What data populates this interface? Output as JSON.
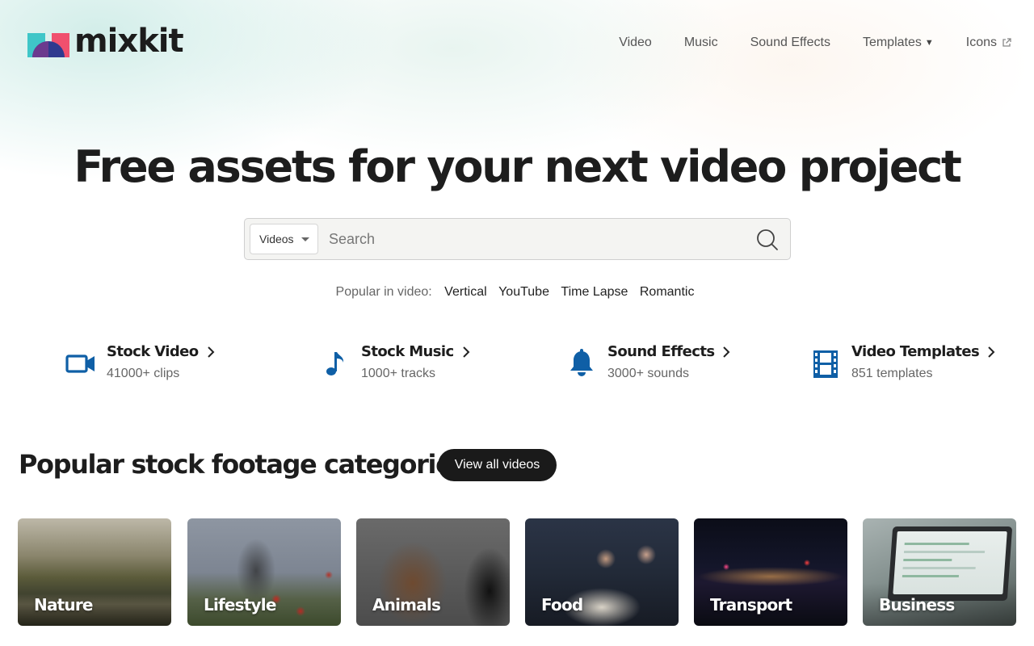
{
  "brand": {
    "name": "mixkit"
  },
  "nav": [
    {
      "label": "Video"
    },
    {
      "label": "Music"
    },
    {
      "label": "Sound Effects"
    },
    {
      "label": "Templates"
    },
    {
      "label": "Icons"
    }
  ],
  "hero": {
    "title": "Free assets for your next video project"
  },
  "search": {
    "type_selected": "Videos",
    "placeholder": "Search"
  },
  "popular": {
    "label": "Popular in video:",
    "tags": [
      "Vertical",
      "YouTube",
      "Time Lapse",
      "Romantic"
    ]
  },
  "stats": [
    {
      "title": "Stock Video",
      "sub": "41000+ clips",
      "icon": "video-camera-icon"
    },
    {
      "title": "Stock Music",
      "sub": "1000+ tracks",
      "icon": "music-note-icon"
    },
    {
      "title": "Sound Effects",
      "sub": "3000+ sounds",
      "icon": "bell-icon"
    },
    {
      "title": "Video Templates",
      "sub": "851 templates",
      "icon": "film-strip-icon"
    }
  ],
  "categories": {
    "title": "Popular stock footage categories",
    "view_all": "View all videos",
    "items": [
      {
        "label": "Nature"
      },
      {
        "label": "Lifestyle"
      },
      {
        "label": "Animals"
      },
      {
        "label": "Food"
      },
      {
        "label": "Transport"
      },
      {
        "label": "Business"
      }
    ]
  },
  "colors": {
    "accent_blue": "#0f5fa6",
    "dark_button": "#1a1a1a",
    "logo_teal": "#3fc6c8",
    "logo_pink": "#f0506e",
    "logo_navy": "#2f3a8f"
  }
}
